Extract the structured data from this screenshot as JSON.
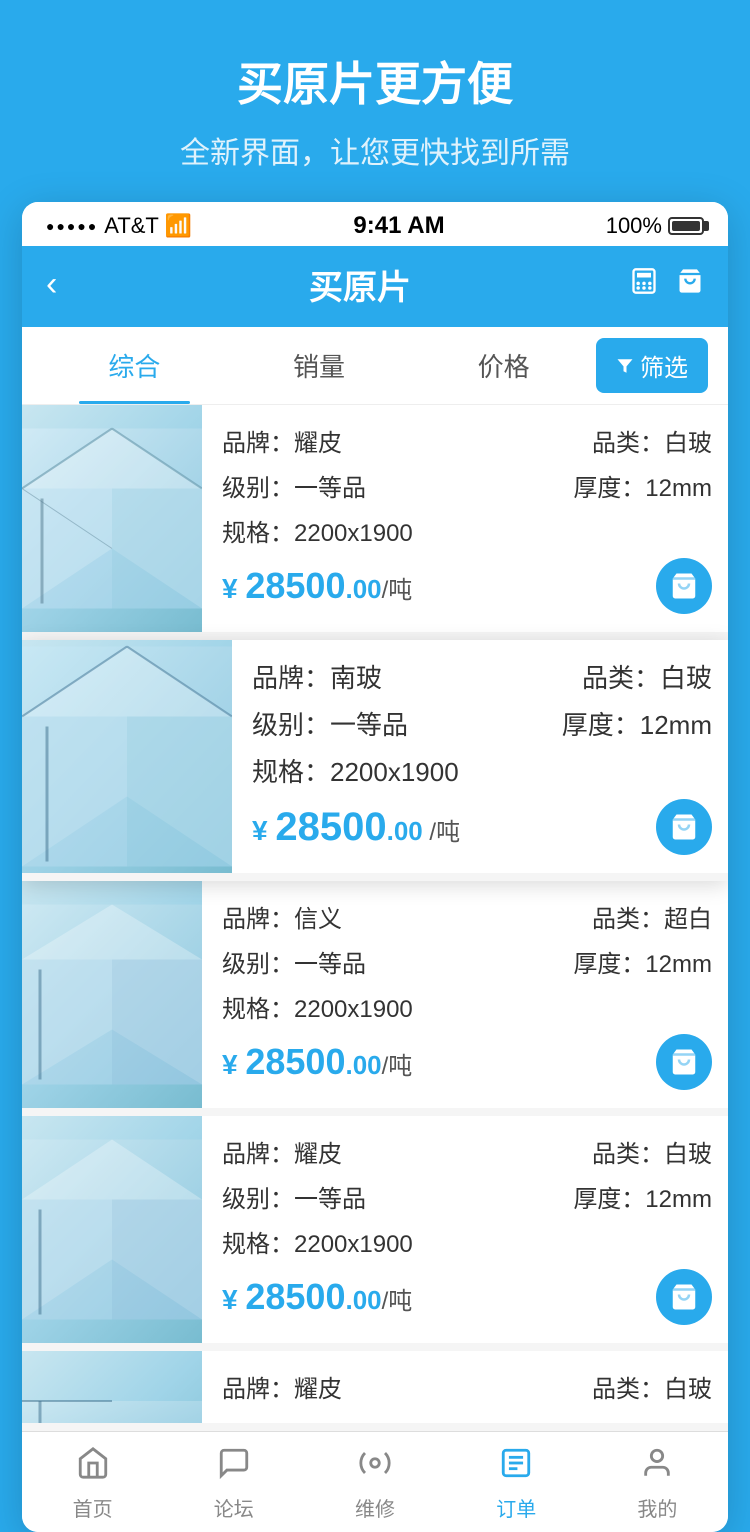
{
  "promo": {
    "title": "买原片更方便",
    "subtitle": "全新界面，让您更快找到所需"
  },
  "statusBar": {
    "carrier": "AT&T",
    "time": "9:41 AM",
    "battery": "100%"
  },
  "navbar": {
    "title": "买原片",
    "back": "‹"
  },
  "filterBar": {
    "tabs": [
      "综合",
      "销量",
      "价格"
    ],
    "activeTab": 0,
    "filterLabel": "筛选"
  },
  "products": [
    {
      "brand_label": "品牌：",
      "brand": "耀皮",
      "category_label": "品类：",
      "category": "白玻",
      "grade_label": "级别：",
      "grade": "一等品",
      "thickness_label": "厚度：",
      "thickness": "12mm",
      "spec_label": "规格：",
      "spec": "2200x1900",
      "price_prefix": "¥",
      "price_main": "28500",
      "price_decimal": ".00",
      "price_unit": "/吨",
      "highlighted": false
    },
    {
      "brand_label": "品牌：",
      "brand": "南玻",
      "category_label": "品类：",
      "category": "白玻",
      "grade_label": "级别：",
      "grade": "一等品",
      "thickness_label": "厚度：",
      "thickness": "12mm",
      "spec_label": "规格：",
      "spec": "2200x1900",
      "price_prefix": "¥",
      "price_main": "28500",
      "price_decimal": ".00",
      "price_unit": "/吨",
      "highlighted": true
    },
    {
      "brand_label": "品牌：",
      "brand": "信义",
      "category_label": "品类：",
      "category": "超白",
      "grade_label": "级别：",
      "grade": "一等品",
      "thickness_label": "厚度：",
      "thickness": "12mm",
      "spec_label": "规格：",
      "spec": "2200x1900",
      "price_prefix": "¥",
      "price_main": "28500",
      "price_decimal": ".00",
      "price_unit": "/吨",
      "highlighted": false
    },
    {
      "brand_label": "品牌：",
      "brand": "耀皮",
      "category_label": "品类：",
      "category": "白玻",
      "grade_label": "级别：",
      "grade": "一等品",
      "thickness_label": "厚度：",
      "thickness": "12mm",
      "spec_label": "规格：",
      "spec": "2200x1900",
      "price_prefix": "¥",
      "price_main": "28500",
      "price_decimal": ".00",
      "price_unit": "/吨",
      "highlighted": false
    },
    {
      "brand_label": "品牌：",
      "brand": "耀皮",
      "category_label": "品类：",
      "category": "白玻",
      "grade_label": "级别：",
      "grade": "",
      "thickness_label": "厚度：",
      "thickness": "",
      "spec_label": "",
      "spec": "",
      "price_prefix": "",
      "price_main": "",
      "price_decimal": "",
      "price_unit": "",
      "highlighted": false,
      "partial": true
    }
  ],
  "bottomNav": [
    {
      "label": "首页",
      "icon": "home",
      "active": false
    },
    {
      "label": "论坛",
      "icon": "forum",
      "active": false
    },
    {
      "label": "维修",
      "icon": "wrench",
      "active": false
    },
    {
      "label": "订单",
      "icon": "list",
      "active": true
    },
    {
      "label": "我的",
      "icon": "person",
      "active": false
    }
  ]
}
